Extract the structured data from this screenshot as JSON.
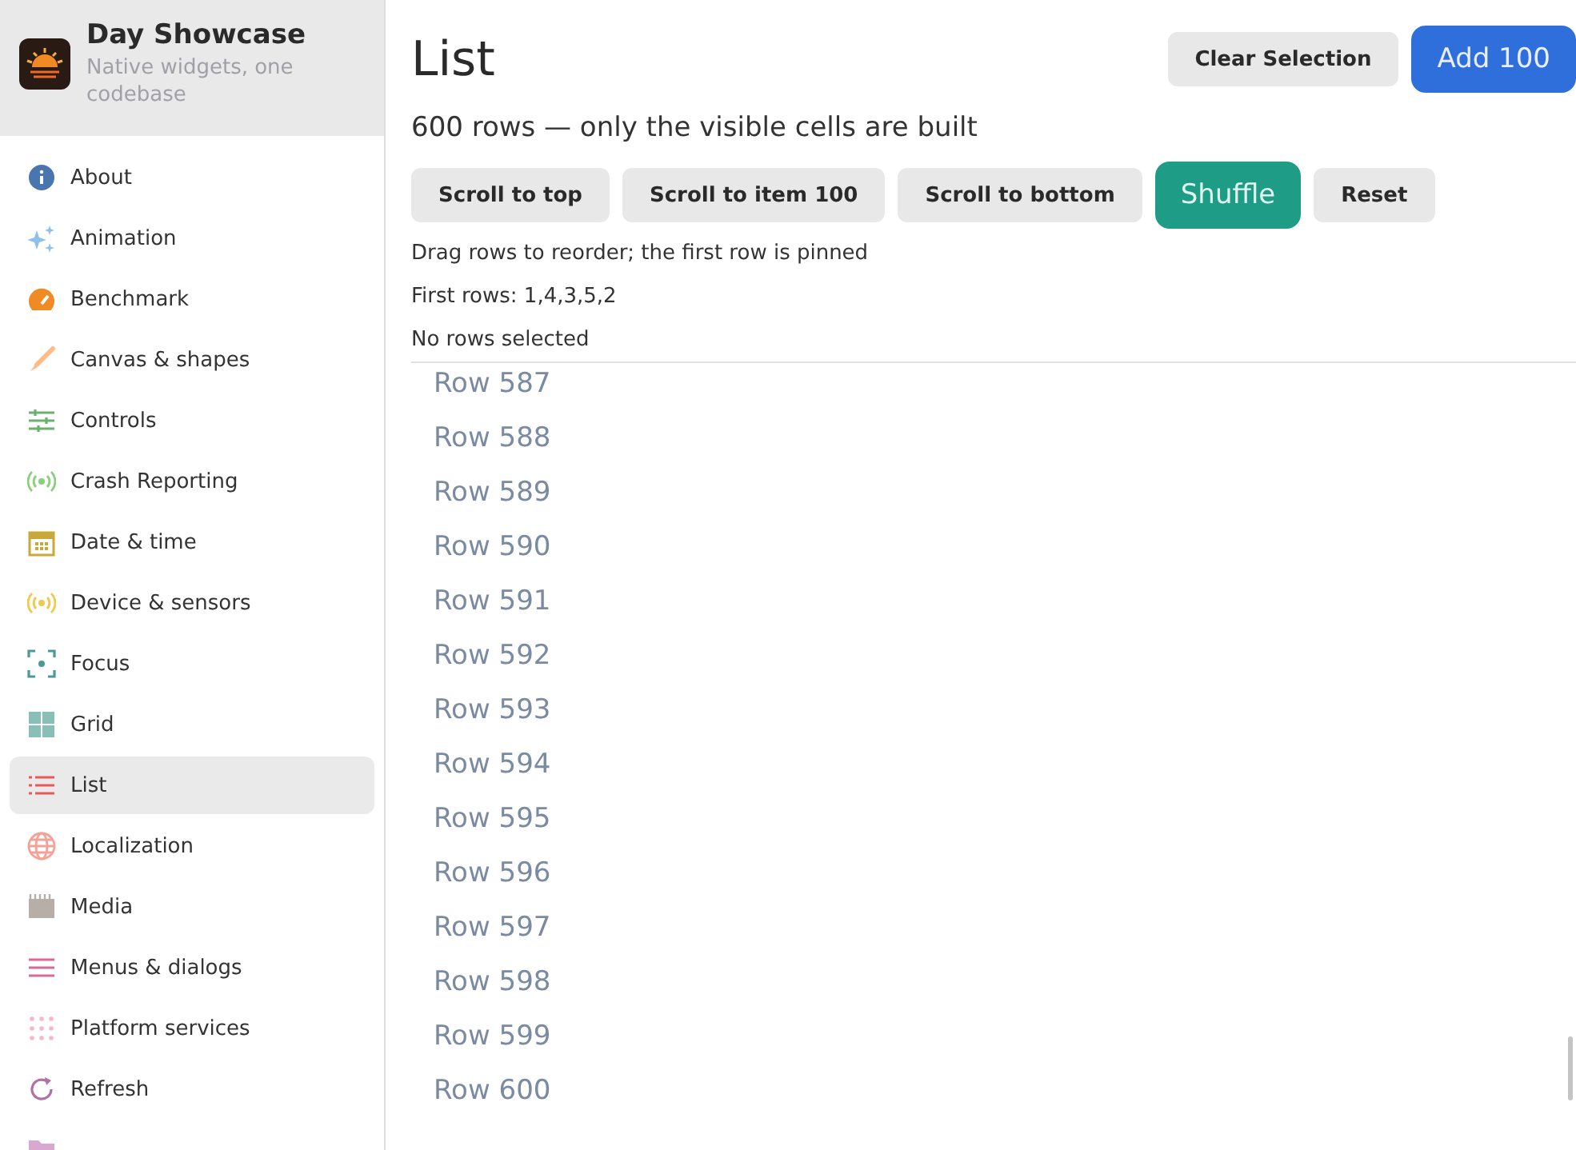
{
  "app": {
    "title": "Day Showcase",
    "subtitle": "Native widgets, one codebase"
  },
  "sidebar": {
    "items": [
      {
        "label": "About",
        "selected": false
      },
      {
        "label": "Animation",
        "selected": false
      },
      {
        "label": "Benchmark",
        "selected": false
      },
      {
        "label": "Canvas & shapes",
        "selected": false
      },
      {
        "label": "Controls",
        "selected": false
      },
      {
        "label": "Crash Reporting",
        "selected": false
      },
      {
        "label": "Date & time",
        "selected": false
      },
      {
        "label": "Device & sensors",
        "selected": false
      },
      {
        "label": "Focus",
        "selected": false
      },
      {
        "label": "Grid",
        "selected": false
      },
      {
        "label": "List",
        "selected": true
      },
      {
        "label": "Localization",
        "selected": false
      },
      {
        "label": "Media",
        "selected": false
      },
      {
        "label": "Menus & dialogs",
        "selected": false
      },
      {
        "label": "Platform services",
        "selected": false
      },
      {
        "label": "Refresh",
        "selected": false
      }
    ]
  },
  "page": {
    "title": "List",
    "header_buttons": [
      {
        "label": "Clear Selection",
        "kind": "secondary"
      },
      {
        "label": "Add 100",
        "kind": "primary"
      }
    ],
    "subtitle": "600 rows — only the visible cells are built",
    "toolbar": [
      {
        "label": "Scroll to top",
        "kind": "secondary"
      },
      {
        "label": "Scroll to item 100",
        "kind": "secondary"
      },
      {
        "label": "Scroll to bottom",
        "kind": "secondary"
      },
      {
        "label": "Shuffle",
        "kind": "accent"
      },
      {
        "label": "Reset",
        "kind": "secondary"
      }
    ],
    "notes": [
      "Drag rows to reorder; the first row is pinned",
      "First rows: 1,4,3,5,2",
      "No rows selected"
    ],
    "rows": [
      {
        "label": "Row 587",
        "selected": false
      },
      {
        "label": "Row 588",
        "selected": false
      },
      {
        "label": "Row 589",
        "selected": false
      },
      {
        "label": "Row 590",
        "selected": false
      },
      {
        "label": "Row 591",
        "selected": false
      },
      {
        "label": "Row 592",
        "selected": false
      },
      {
        "label": "Row 593",
        "selected": false
      },
      {
        "label": "Row 594",
        "selected": false
      },
      {
        "label": "Row 595",
        "selected": false
      },
      {
        "label": "Row 596",
        "selected": false
      },
      {
        "label": "Row 597",
        "selected": false
      },
      {
        "label": "Row 598",
        "selected": false
      },
      {
        "label": "Row 599",
        "selected": false
      },
      {
        "label": "Row 600",
        "selected": false
      }
    ]
  }
}
